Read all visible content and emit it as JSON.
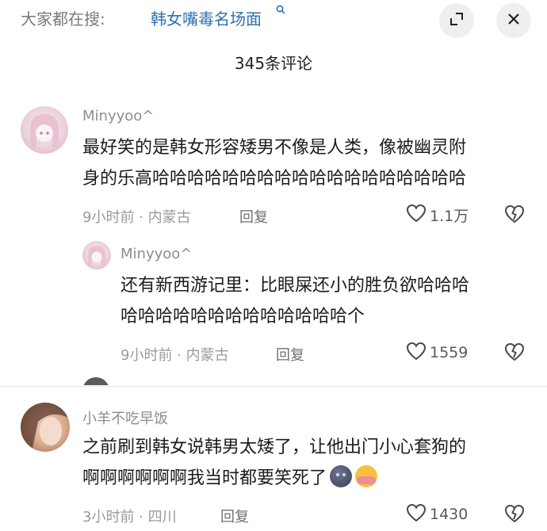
{
  "header": {
    "search_prefix": "大家都在搜:",
    "search_term": "韩女嘴毒名场面"
  },
  "comment_count_label": "345条评论",
  "comments": [
    {
      "username": "Minyyoo^",
      "text_lines": [
        "最好笑的是韩女形容矮男不像是人类，像被幽灵附",
        "身的乐高哈哈哈哈哈哈哈哈哈哈哈哈哈哈哈哈哈哈"
      ],
      "meta": "9小时前 · 内蒙古",
      "reply_label": "回复",
      "likes": "1.1万"
    },
    {
      "username": "Minyyoo^",
      "text_lines": [
        "还有新西游记里：比眼屎还小的胜负欲哈哈哈",
        "哈哈哈哈哈哈哈哈哈哈哈哈哈个"
      ],
      "meta": "9小时前 · 内蒙古",
      "reply_label": "回复",
      "likes": "1559"
    },
    {
      "username": "小羊不吃早饭",
      "text_lines": [
        "之前刷到韩女说韩男太矮了，让他出门小心套狗的",
        "啊啊啊啊啊啊我当时都要笑死了"
      ],
      "meta": "3小时前 · 四川",
      "reply_label": "回复",
      "likes": "1430"
    }
  ],
  "icons": {
    "search": "search-icon",
    "expand": "expand-icon",
    "close": "close-icon",
    "like": "heart-outline-icon",
    "dislike": "broken-heart-icon"
  }
}
